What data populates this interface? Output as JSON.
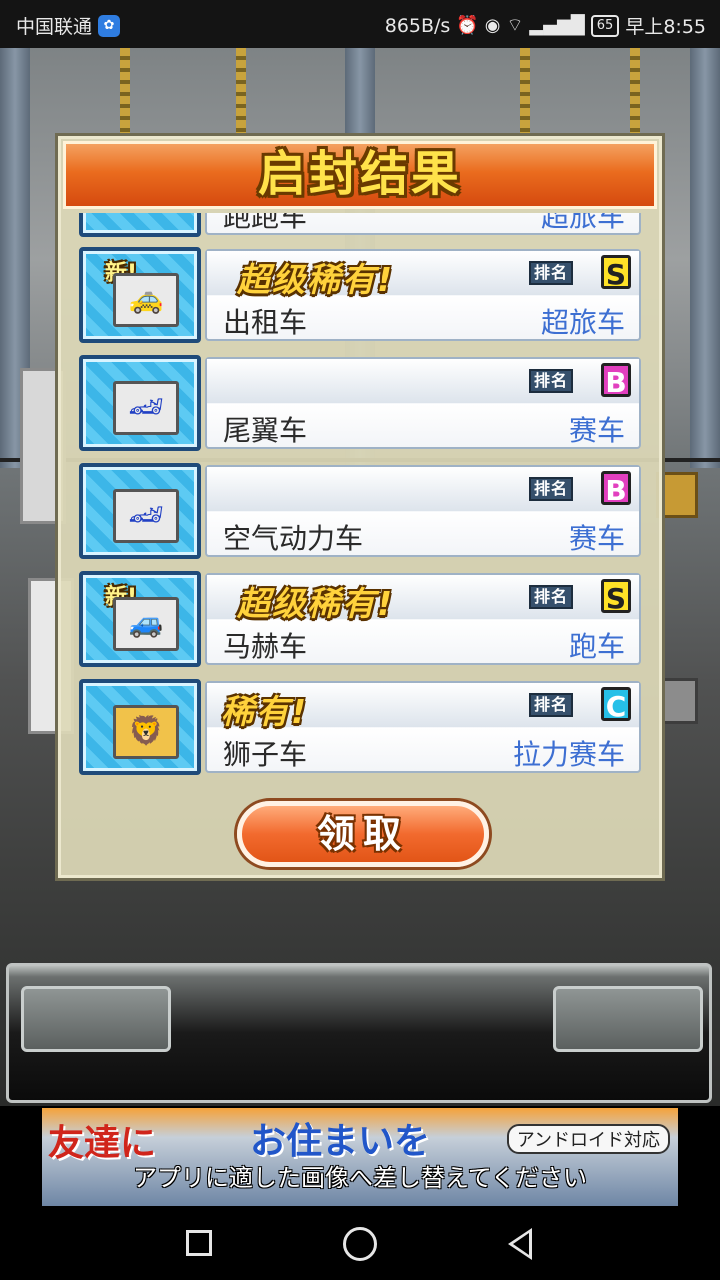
{
  "status_bar": {
    "carrier": "中国联通",
    "speed": "865B/s",
    "battery": "65",
    "time": "早上8:55",
    "icons": [
      "paw-notification-icon",
      "alarm-icon",
      "eye-icon",
      "wifi-icon",
      "4g-signal-icon",
      "battery-icon"
    ]
  },
  "dialog": {
    "title": "启封结果",
    "rank_label": "排名",
    "new_badge": "新!",
    "items": [
      {
        "name": "跑跑车",
        "category": "超旅车",
        "rarity": "",
        "grade": "",
        "is_new": false
      },
      {
        "name": "出租车",
        "category": "超旅车",
        "rarity": "超级稀有!",
        "grade": "S",
        "is_new": true
      },
      {
        "name": "尾翼车",
        "category": "赛车",
        "rarity": "",
        "grade": "B",
        "is_new": false
      },
      {
        "name": "空气动力车",
        "category": "赛车",
        "rarity": "",
        "grade": "B",
        "is_new": false
      },
      {
        "name": "马赫车",
        "category": "跑车",
        "rarity": "超级稀有!",
        "grade": "S",
        "is_new": true
      },
      {
        "name": "狮子车",
        "category": "拉力赛车",
        "rarity": "稀有!",
        "grade": "C",
        "is_new": false
      }
    ],
    "claim_button": "领取"
  },
  "ad": {
    "headline_left": "友達に",
    "headline_right": "お住まいを",
    "tag": "アンドロイド対応",
    "caption": "アプリに適した画像へ差し替えてください"
  },
  "colors": {
    "title_orange": "#ea6c1e",
    "grade_S": "#ffe227",
    "grade_B": "#e23fbf",
    "grade_C": "#26c0e8",
    "category_blue": "#3d6fd2"
  }
}
